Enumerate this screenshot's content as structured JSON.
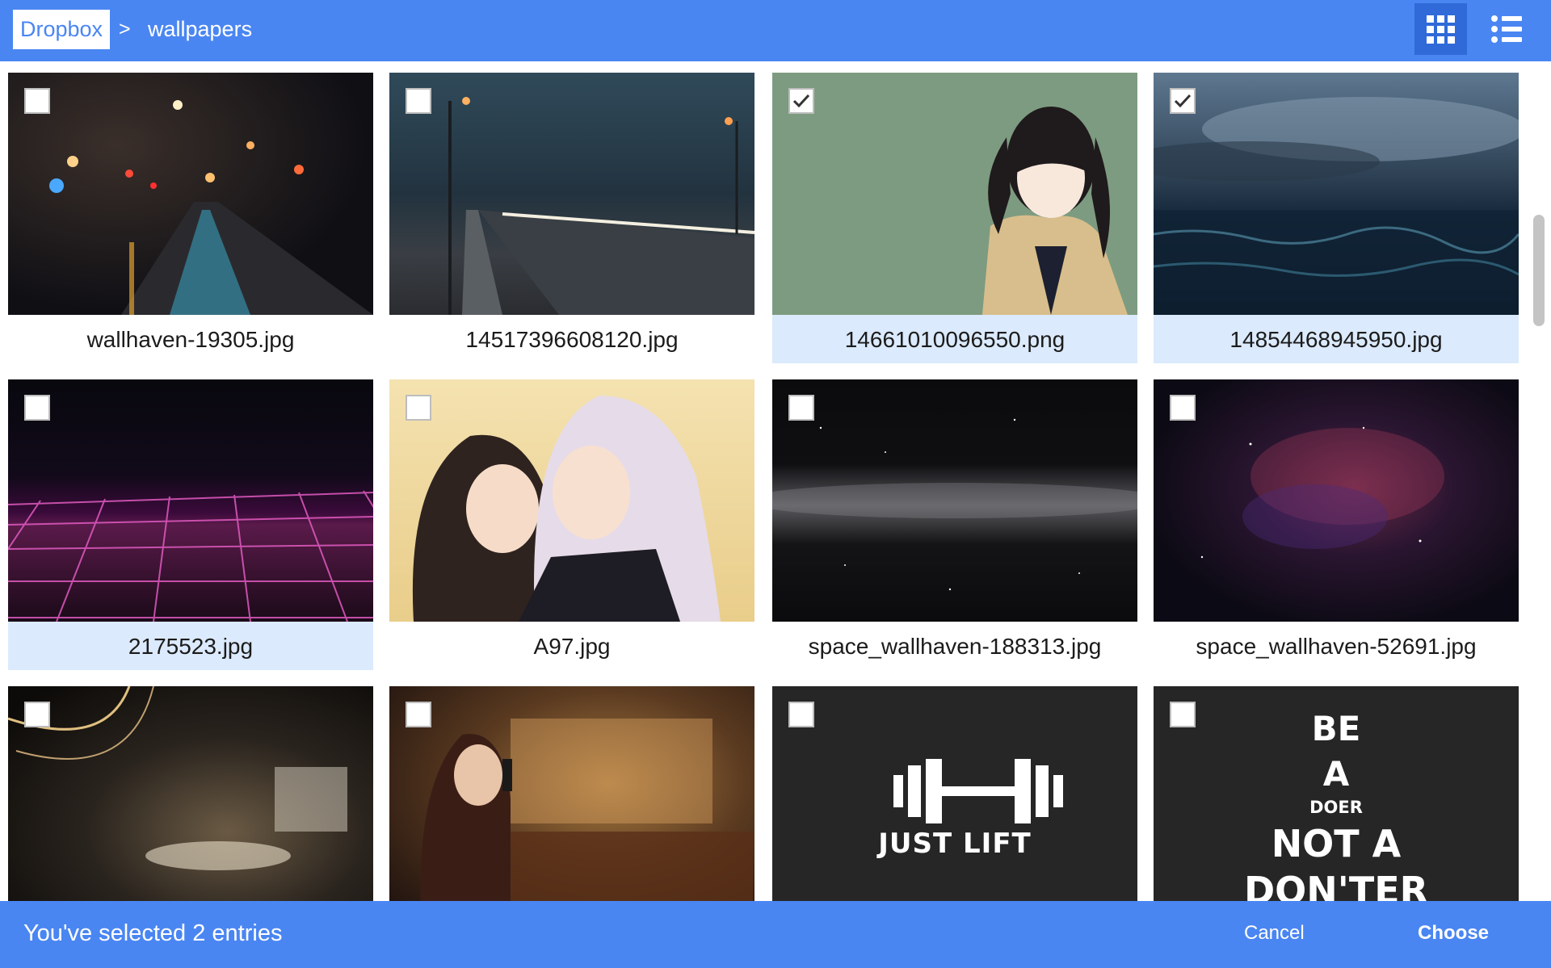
{
  "breadcrumb": {
    "root": "Dropbox",
    "separator": ">",
    "current": "wallpapers"
  },
  "view_toggle": {
    "active": "grid",
    "options": [
      "grid-view-icon",
      "list-view-icon"
    ]
  },
  "files": [
    {
      "name": "wallhaven-19305.jpg",
      "selected": false
    },
    {
      "name": "14517396608120.jpg",
      "selected": false
    },
    {
      "name": "14661010096550.png",
      "selected": true
    },
    {
      "name": "14854468945950.jpg",
      "selected": true
    },
    {
      "name": "2175523.jpg",
      "selected": false,
      "highlighted": true
    },
    {
      "name": "A97.jpg",
      "selected": false
    },
    {
      "name": "space_wallhaven-188313.jpg",
      "selected": false
    },
    {
      "name": "space_wallhaven-52691.jpg",
      "selected": false
    },
    {
      "name": "",
      "selected": false
    },
    {
      "name": "",
      "selected": false
    },
    {
      "name": "",
      "selected": false,
      "poster_text": "JUST LIFT"
    },
    {
      "name": "",
      "selected": false,
      "poster_text": [
        "BE",
        "A",
        "DOER",
        "NOT A",
        "DON'TER"
      ]
    }
  ],
  "footer": {
    "status": "You've selected 2 entries",
    "cancel_label": "Cancel",
    "choose_label": "Choose"
  },
  "colors": {
    "accent": "#4a86f2",
    "active_view_button": "#2f6ad8",
    "selection_highlight": "#dbeafc"
  }
}
